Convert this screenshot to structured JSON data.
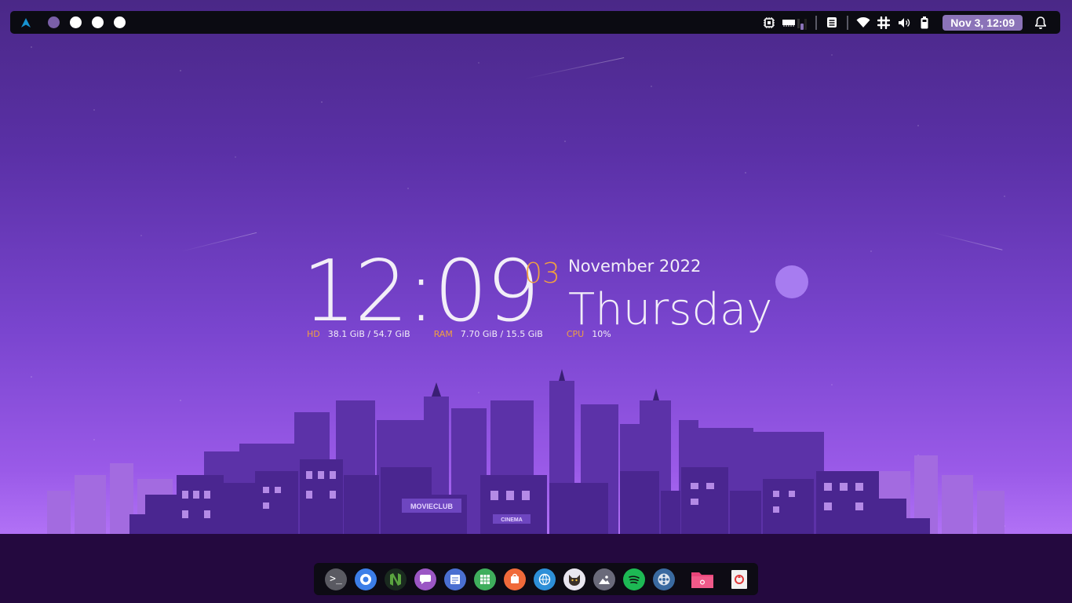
{
  "workspaces": [
    {
      "active": true
    },
    {
      "active": false
    },
    {
      "active": false
    },
    {
      "active": false
    }
  ],
  "topbar": {
    "icons": [
      "arch-linux-icon",
      "cpu-icon",
      "memory-icon",
      "keyboard-layout-icon",
      "clipboard-icon",
      "wifi-icon",
      "slack-icon",
      "volume-icon",
      "battery-icon",
      "notification-bell-icon"
    ],
    "datetime": "Nov  3, 12:09"
  },
  "widget": {
    "time": "12:09",
    "day": "03",
    "month_year": "November 2022",
    "weekday": "Thursday",
    "stats": [
      {
        "label": "HD",
        "value": "38.1 GiB / 54.7 GiB"
      },
      {
        "label": "RAM",
        "value": "7.70 GiB / 15.5 GiB"
      },
      {
        "label": "CPU",
        "value": "10%"
      }
    ]
  },
  "city_signs": {
    "movieclub": "MOVIECLUB",
    "cinema": "CINEMA"
  },
  "dock": {
    "apps": [
      "terminal-icon",
      "chromium-icon",
      "neovim-icon",
      "hexchat-icon",
      "text-editor-icon",
      "spreadsheet-icon",
      "app-store-icon",
      "web-browser-icon",
      "cat-app-icon",
      "image-viewer-icon",
      "spotify-icon",
      "film-reel-icon",
      "files-folder-icon",
      "trash-icon"
    ]
  },
  "colors": {
    "accent": "#f0a040",
    "pill": "#8b73b8",
    "bar": "#0b0b12",
    "moon": "#a77cf0"
  }
}
